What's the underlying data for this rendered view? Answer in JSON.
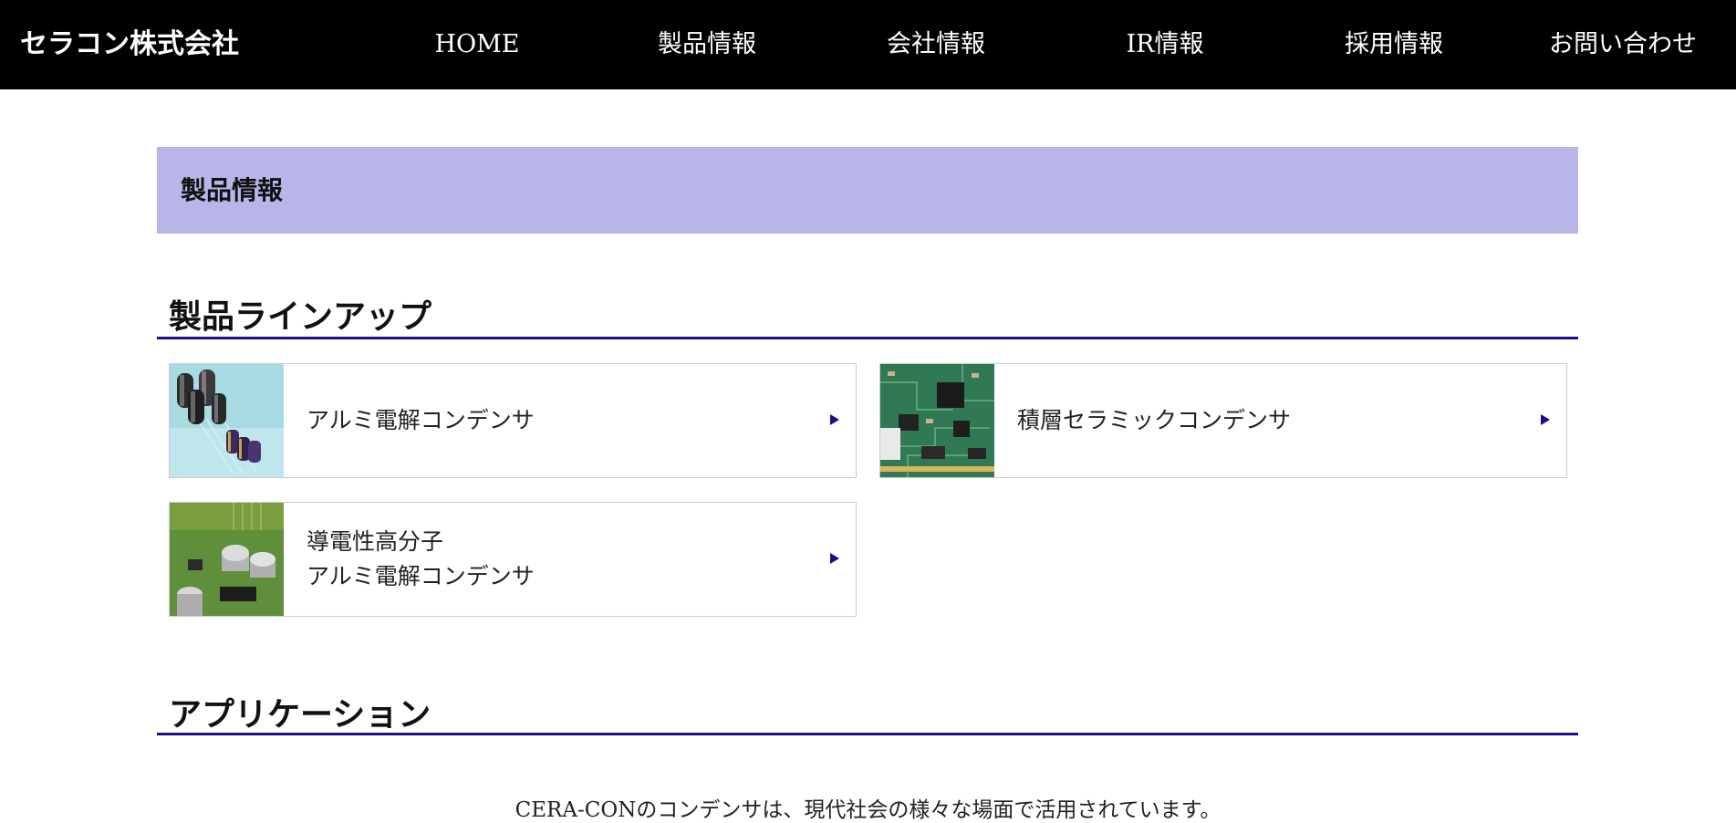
{
  "header": {
    "brand": "セラコン株式会社",
    "nav": [
      {
        "label": "HOME"
      },
      {
        "label": "製品情報"
      },
      {
        "label": "会社情報"
      },
      {
        "label": "IR情報"
      },
      {
        "label": "採用情報"
      },
      {
        "label": "お問い合わせ"
      }
    ]
  },
  "banner": {
    "title": "製品情報"
  },
  "lineup": {
    "title": "製品ラインアップ",
    "products": [
      {
        "line1": "アルミ電解コンデンサ",
        "line2": "",
        "image": "capacitor-photo"
      },
      {
        "line1": "積層セラミックコンデンサ",
        "line2": "",
        "image": "circuit-board-photo"
      },
      {
        "line1": "導電性高分子",
        "line2": "アルミ電解コンデンサ",
        "image": "pcb-capacitor-photo"
      }
    ]
  },
  "applications": {
    "title": "アプリケーション",
    "intro": "CERA-CONのコンデンサは、現代社会の様々な場面で活用されています。"
  },
  "colors": {
    "header_bg": "#000000",
    "banner_bg": "#b8b6e8",
    "accent": "#1a0f8e"
  }
}
